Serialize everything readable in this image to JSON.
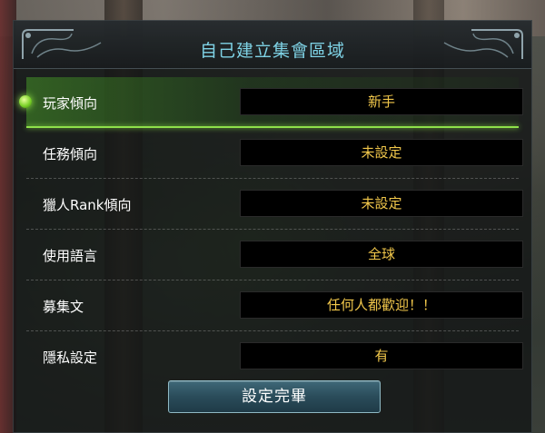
{
  "title": "自己建立集會區域",
  "rows": [
    {
      "label": "玩家傾向",
      "value": "新手",
      "active": true
    },
    {
      "label": "任務傾向",
      "value": "未設定",
      "active": false
    },
    {
      "label": "獵人Rank傾向",
      "value": "未設定",
      "active": false
    },
    {
      "label": "使用語言",
      "value": "全球",
      "active": false
    },
    {
      "label": "募集文",
      "value": "任何人都歡迎！！",
      "active": false
    },
    {
      "label": "隱私設定",
      "value": "有",
      "active": false
    }
  ],
  "confirm_label": "設定完畢",
  "colors": {
    "title": "#7fd3e6",
    "value_text": "#f2c84b",
    "active_highlight": "#8ee04a",
    "button_bg": "#2a4c5a"
  }
}
